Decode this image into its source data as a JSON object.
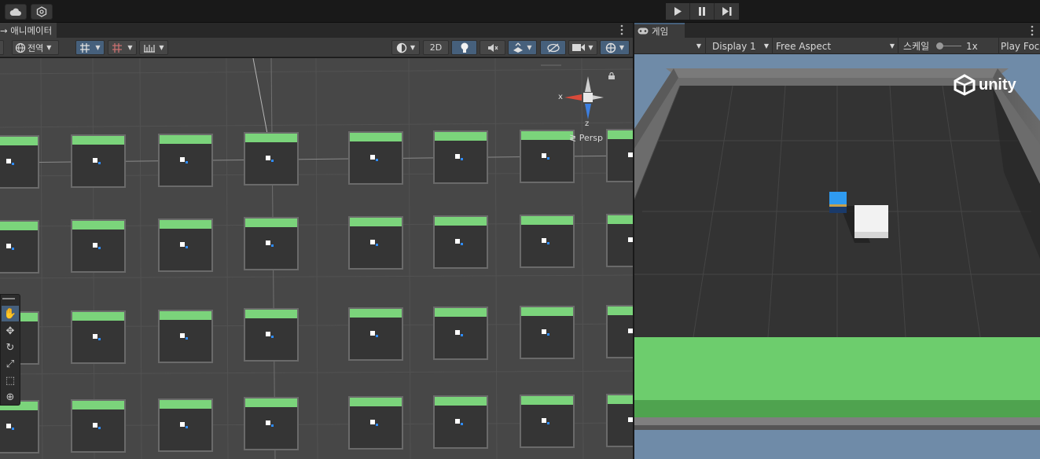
{
  "topbar": {
    "cloud_icon": "cloud-icon",
    "collab_icon": "settings-hex-icon",
    "play_icon": "play-icon",
    "pause_icon": "pause-icon",
    "step_icon": "step-icon",
    "more_icon": "kebab-icon"
  },
  "scene": {
    "tab_label": "→ 애니메이터",
    "global_label": "전역",
    "mode_2d_label": "2D",
    "persp_label": "≷ Persp",
    "axis_x": "x",
    "axis_z": "z"
  },
  "game": {
    "tab_label": "게임",
    "display_label": "Display 1",
    "aspect_label": "Free Aspect",
    "scale_label": "스케일",
    "scale_value": "1x",
    "play_focus_label": "Play Focu",
    "logo_text": "unity"
  },
  "colors": {
    "accent": "#46607c",
    "green_bar": "#7bd47b",
    "floor_green": "#6dcd6d",
    "player_blue": "#2f9bf0"
  }
}
